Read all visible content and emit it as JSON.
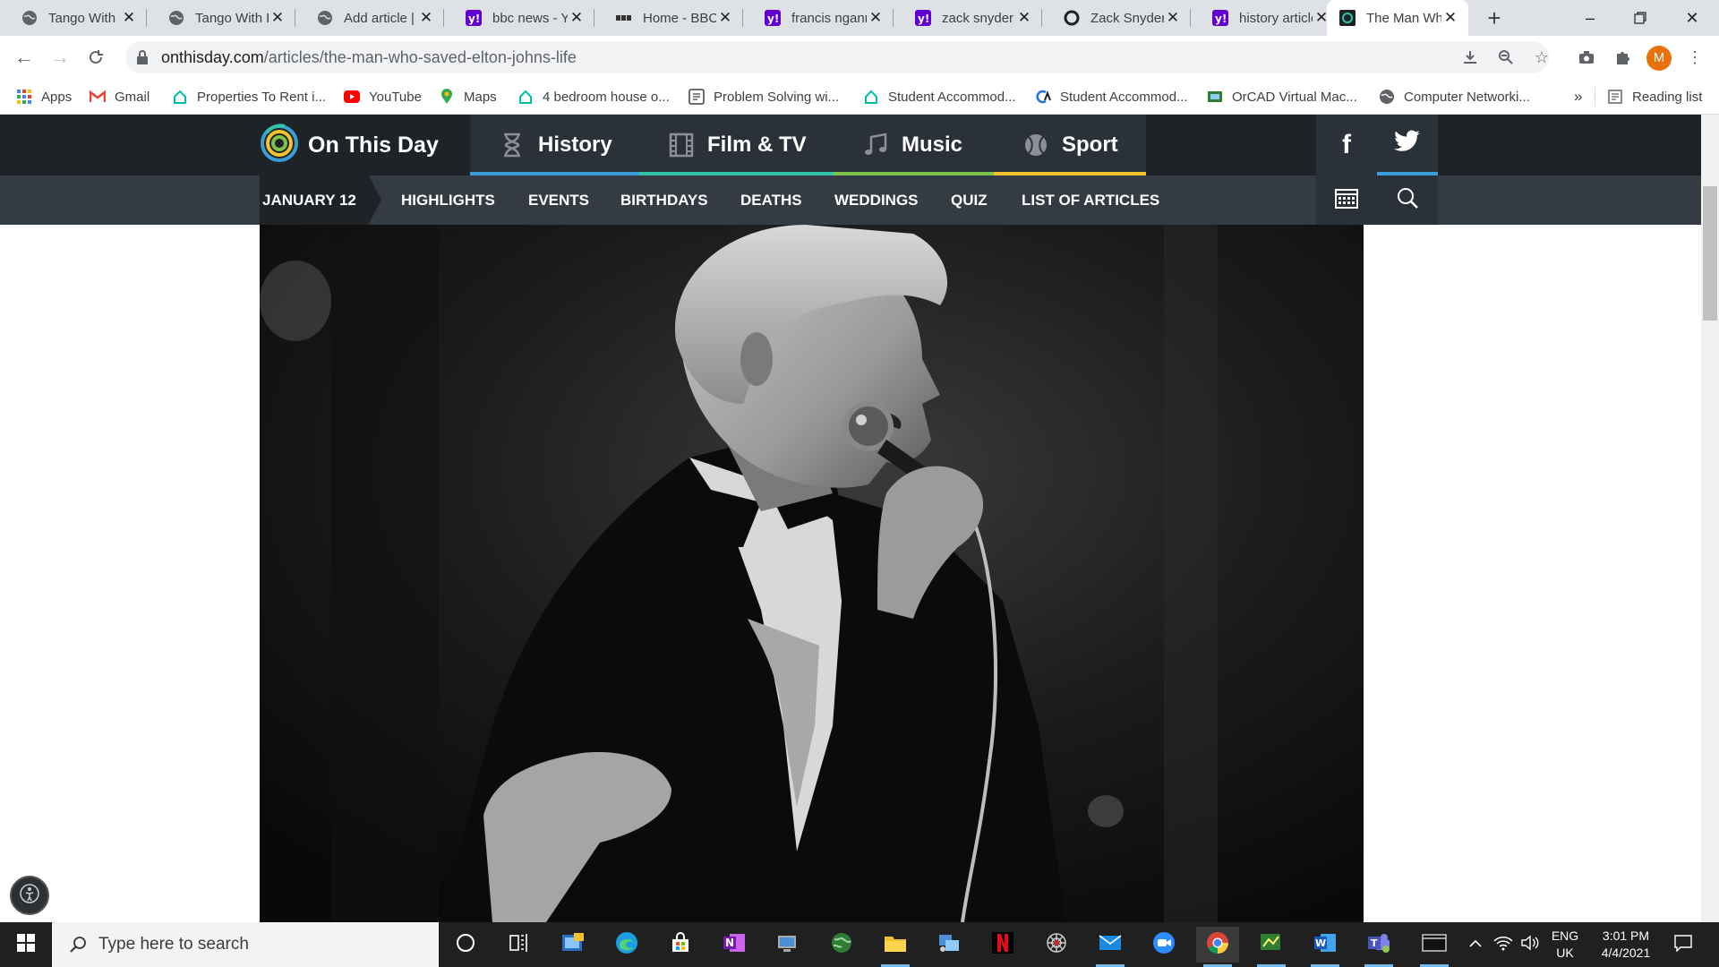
{
  "tabs": [
    {
      "title": "Tango With Django",
      "favicon": "globe-icon"
    },
    {
      "title": "Tango With Django",
      "favicon": "globe-icon"
    },
    {
      "title": "Add article | On This Day",
      "favicon": "globe-icon"
    },
    {
      "title": "bbc news - Yahoo Search",
      "favicon": "yahoo-icon"
    },
    {
      "title": "Home - BBC News",
      "favicon": "bbc-icon"
    },
    {
      "title": "francis ngannou",
      "favicon": "yahoo-icon"
    },
    {
      "title": "zack snyder justice league",
      "favicon": "yahoo-icon"
    },
    {
      "title": "Zack Snyder's Justice League",
      "favicon": "circle-icon"
    },
    {
      "title": "history articles",
      "favicon": "yahoo-icon"
    },
    {
      "title": "The Man Who Saved Elton John's Life",
      "favicon": "onthisday-icon"
    }
  ],
  "address_bar": {
    "domain": "onthisday.com",
    "path": "/articles/the-man-who-saved-elton-johns-life"
  },
  "profile_initial": "M",
  "bookmarks": [
    {
      "label": "Apps",
      "icon": "apps-grid-icon"
    },
    {
      "label": "Gmail",
      "icon": "gmail-icon"
    },
    {
      "label": "Properties To Rent i...",
      "icon": "house-icon"
    },
    {
      "label": "YouTube",
      "icon": "youtube-icon"
    },
    {
      "label": "Maps",
      "icon": "maps-pin-icon"
    },
    {
      "label": "4 bedroom house o...",
      "icon": "house-icon"
    },
    {
      "label": "Problem Solving wi...",
      "icon": "book-icon"
    },
    {
      "label": "Student Accommod...",
      "icon": "house-icon"
    },
    {
      "label": "Student Accommod...",
      "icon": "ca-icon"
    },
    {
      "label": "OrCAD Virtual Mac...",
      "icon": "orcad-icon"
    },
    {
      "label": "Computer Networki...",
      "icon": "globe-icon"
    }
  ],
  "bookmarks_overflow": "»",
  "reading_list": "Reading list",
  "site": {
    "logo_text": "On This Day",
    "categories": [
      {
        "label": "History",
        "icon": "hourglass-icon",
        "color": "#3b9dd8"
      },
      {
        "label": "Film & TV",
        "icon": "film-icon",
        "color": "#30c5a7"
      },
      {
        "label": "Music",
        "icon": "music-note-icon",
        "color": "#7cc349"
      },
      {
        "label": "Sport",
        "icon": "ball-icon",
        "color": "#f2c12e"
      }
    ],
    "date_label": "JANUARY 12",
    "sub_links": [
      "HIGHLIGHTS",
      "EVENTS",
      "BIRTHDAYS",
      "DEATHS",
      "WEDDINGS",
      "QUIZ",
      "LIST OF ARTICLES"
    ],
    "social": [
      {
        "label": "f",
        "icon": "facebook-icon"
      },
      {
        "label": "",
        "icon": "twitter-icon",
        "color": "#3b9dd8"
      }
    ]
  },
  "taskbar": {
    "search_placeholder": "Type here to search",
    "language": "ENG",
    "region": "UK",
    "time": "3:01 PM",
    "date": "4/4/2021"
  }
}
